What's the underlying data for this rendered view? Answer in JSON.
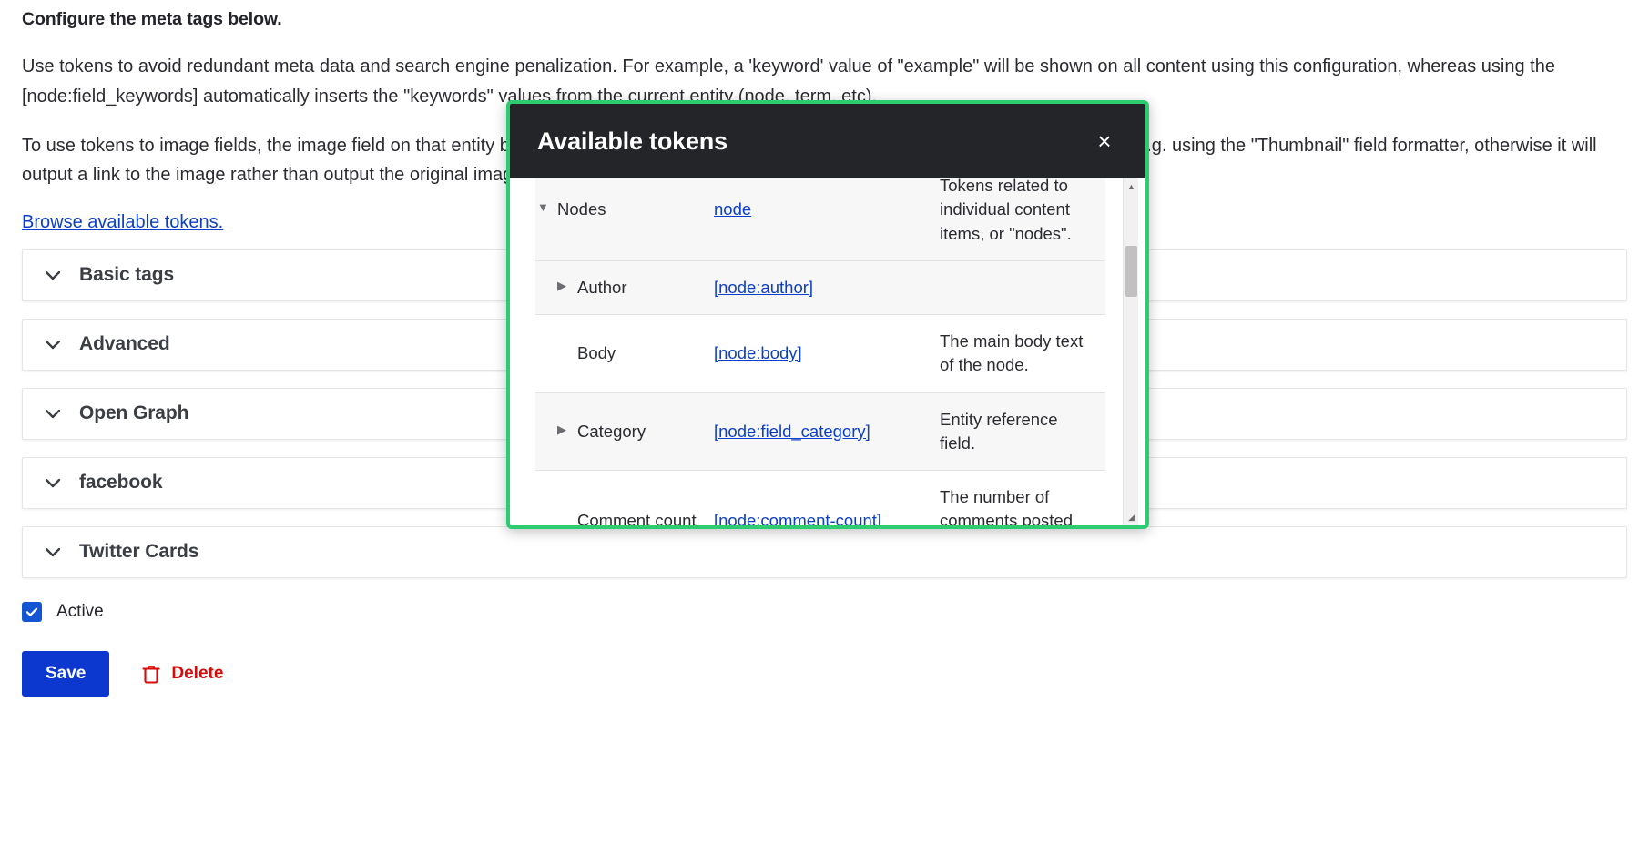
{
  "intro": {
    "title": "Configure the meta tags below.",
    "paragraph1": "Use tokens to avoid redundant meta data and search engine penalization. For example, a 'keyword' value of \"example\" will be shown on all content using this configuration, whereas using the [node:field_keywords] automatically inserts the \"keywords\" values from the current entity (node, term, etc).",
    "paragraph2": "To use tokens to image fields, the image field on that entity bundle/type field must not be hidden, and it must be set to output as an image, e.g. using the \"Thumbnail\" field formatter, otherwise it will output a link to the image rather than output the original image; see individual meta tag descriptions for size recommendations.",
    "browse_tokens_link": "Browse available tokens."
  },
  "accordion": {
    "items": [
      {
        "label": "Basic tags"
      },
      {
        "label": "Advanced"
      },
      {
        "label": "Open Graph"
      },
      {
        "label": "facebook"
      },
      {
        "label": "Twitter Cards"
      }
    ]
  },
  "active_checkbox": {
    "label": "Active",
    "checked": true
  },
  "actions": {
    "save_label": "Save",
    "delete_label": "Delete"
  },
  "modal": {
    "title": "Available tokens",
    "close_label": "×",
    "rows": [
      {
        "name": "Nodes",
        "token": "node",
        "description": "Tokens related to individual content items, or \"nodes\".",
        "expander": "▼",
        "indent": 0,
        "stripe": "odd"
      },
      {
        "name": "Author",
        "token": "[node:author]",
        "description": "",
        "expander": "▶",
        "indent": 1,
        "stripe": "odd"
      },
      {
        "name": "Body",
        "token": "[node:body]",
        "description": "The main body text of the node.",
        "expander": "",
        "indent": 1,
        "stripe": "even"
      },
      {
        "name": "Category",
        "token": "[node:field_category]",
        "description": "Entity reference field.",
        "expander": "▶",
        "indent": 1,
        "stripe": "odd"
      },
      {
        "name": "Comment count",
        "token": "[node:comment-count]",
        "description": "The number of comments posted on an entity.",
        "expander": "",
        "indent": 1,
        "stripe": "even"
      }
    ],
    "scroll": {
      "up_arrow": "▲",
      "down_arrow": "◢"
    }
  },
  "colors": {
    "accent_blue": "#0d38d0",
    "link_blue": "#0c3fc7",
    "danger_red": "#d70b0b",
    "modal_border_green": "#2ecc71",
    "modal_header_dark": "#242528"
  }
}
